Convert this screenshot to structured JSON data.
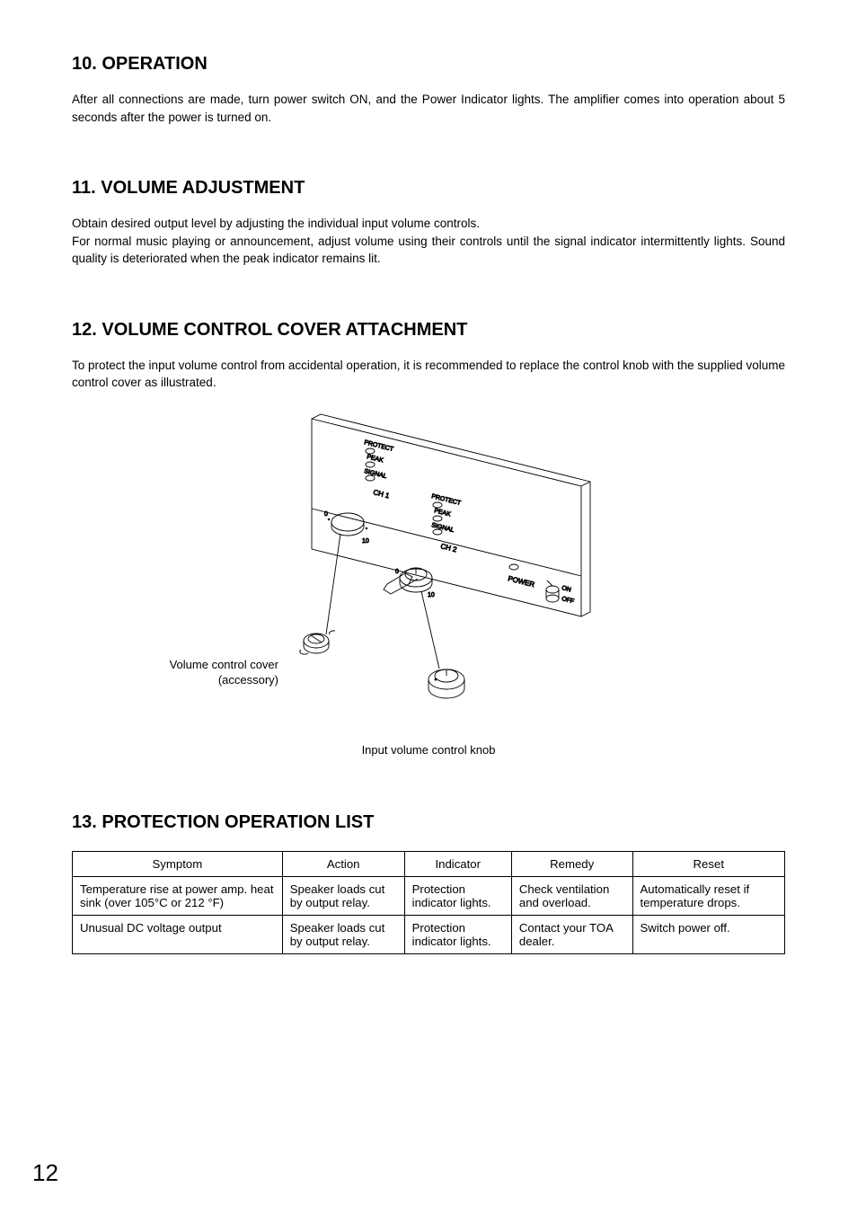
{
  "sections": {
    "s10": {
      "heading": "10. OPERATION",
      "p1": "After all connections are made, turn power switch ON, and the Power Indicator lights. The amplifier comes into operation about 5 seconds after the power is turned on."
    },
    "s11": {
      "heading": "11. VOLUME ADJUSTMENT",
      "p1": "Obtain desired output level by adjusting the individual input volume controls.",
      "p2": "For normal music playing or announcement, adjust volume using their controls until the signal indicator intermittently lights. Sound quality is deteriorated when the peak indicator remains lit."
    },
    "s12": {
      "heading": "12. VOLUME CONTROL COVER ATTACHMENT",
      "p1": "To protect the input volume control from accidental operation, it is recommended to replace the control knob with the supplied volume control cover as illustrated.",
      "fig": {
        "cover_label_l1": "Volume control cover",
        "cover_label_l2": "(accessory)",
        "knob_label": "Input volume control knob",
        "panel": {
          "ch1": "CH 1",
          "ch2": "CH 2",
          "protect": "PROTECT",
          "peak": "PEAK",
          "signal": "SIGNAL",
          "power": "POWER",
          "on": "ON",
          "off": "OFF",
          "scale_0": "0",
          "scale_10": "10"
        }
      }
    },
    "s13": {
      "heading": "13. PROTECTION OPERATION LIST",
      "headers": [
        "Symptom",
        "Action",
        "Indicator",
        "Remedy",
        "Reset"
      ],
      "rows": [
        {
          "symptom": "Temperature rise at power amp. heat sink (over 105°C or 212 °F)",
          "action": "Speaker loads cut by output relay.",
          "indicator": "Protection indicator lights.",
          "remedy": "Check ventilation and overload.",
          "reset": "Automatically reset if temperature drops."
        },
        {
          "symptom": "Unusual DC voltage output",
          "action": "Speaker loads cut by output relay.",
          "indicator": "Protection indicator lights.",
          "remedy": "Contact your TOA dealer.",
          "reset": "Switch power off."
        }
      ]
    }
  },
  "page_number": "12"
}
